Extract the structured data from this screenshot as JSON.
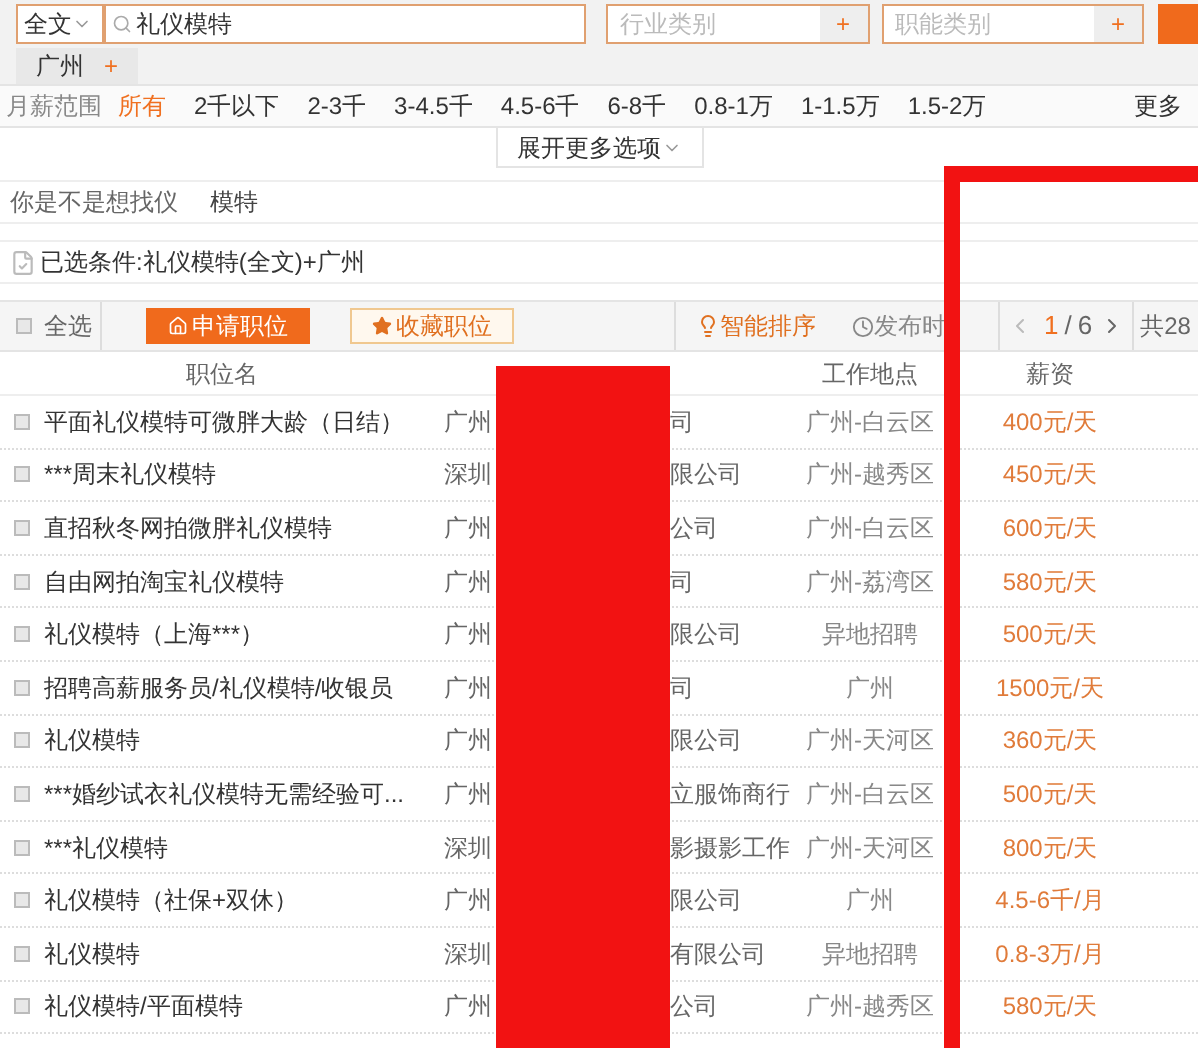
{
  "search": {
    "scope": "全文",
    "query": "礼仪模特",
    "industry_placeholder": "行业类别",
    "function_placeholder": "职能类别",
    "add_symbol": "+"
  },
  "city_tag": {
    "label": "广州",
    "add_symbol": "+"
  },
  "salary_filter": {
    "label": "月薪范围",
    "more": "更多",
    "options": [
      {
        "label": "所有",
        "selected": true
      },
      {
        "label": "2千以下",
        "selected": false
      },
      {
        "label": "2-3千",
        "selected": false
      },
      {
        "label": "3-4.5千",
        "selected": false
      },
      {
        "label": "4.5-6千",
        "selected": false
      },
      {
        "label": "6-8千",
        "selected": false
      },
      {
        "label": "0.8-1万",
        "selected": false
      },
      {
        "label": "1-1.5万",
        "selected": false
      },
      {
        "label": "1.5-2万",
        "selected": false
      }
    ]
  },
  "expand_options": "展开更多选项",
  "suggestion": {
    "prompt": "你是不是想找仪",
    "link": "模特"
  },
  "conditions": "已选条件:礼仪模特(全文)+广州",
  "toolbar": {
    "select_all": "全选",
    "select_all_checked": false,
    "apply": "申请职位",
    "save": "收藏职位",
    "smart_sort": "智能排序",
    "by_date": "发布时",
    "pager": {
      "current": "1",
      "separator": "/",
      "total": "6"
    },
    "count": "共28"
  },
  "table": {
    "columns": [
      "职位名",
      "工作地点",
      "薪资"
    ],
    "rows": [
      {
        "checked": false,
        "title": "平面礼仪模特可微胖大龄（日结）",
        "company_start": "广州",
        "company_end": "司",
        "location": "广州-白云区",
        "salary": "400元/天"
      },
      {
        "checked": false,
        "title": "***周末礼仪模特",
        "company_start": "深圳",
        "company_end": "限公司",
        "location": "广州-越秀区",
        "salary": "450元/天"
      },
      {
        "checked": false,
        "title": "直招秋冬网拍微胖礼仪模特",
        "company_start": "广州",
        "company_end": "公司",
        "location": "广州-白云区",
        "salary": "600元/天"
      },
      {
        "checked": false,
        "title": "自由网拍淘宝礼仪模特",
        "company_start": "广州",
        "company_end": "司",
        "location": "广州-荔湾区",
        "salary": "580元/天"
      },
      {
        "checked": false,
        "title": "礼仪模特（上海***）",
        "company_start": "广州",
        "company_end": "限公司",
        "location": "异地招聘",
        "salary": "500元/天"
      },
      {
        "checked": false,
        "title": "招聘高薪服务员/礼仪模特/收银员",
        "company_start": "广州",
        "company_end": "司",
        "location": "广州",
        "salary": "1500元/天"
      },
      {
        "checked": false,
        "title": "礼仪模特",
        "company_start": "广州",
        "company_end": "限公司",
        "location": "广州-天河区",
        "salary": "360元/天"
      },
      {
        "checked": false,
        "title": "***婚纱试衣礼仪模特无需经验可...",
        "company_start": "广州",
        "company_end": "立服饰商行",
        "location": "广州-白云区",
        "salary": "500元/天"
      },
      {
        "checked": false,
        "title": "***礼仪模特",
        "company_start": "深圳",
        "company_end": "影摄影工作",
        "location": "广州-天河区",
        "salary": "800元/天"
      },
      {
        "checked": false,
        "title": "礼仪模特（社保+双休）",
        "company_start": "广州",
        "company_end": "限公司",
        "location": "广州",
        "salary": "4.5-6千/月"
      },
      {
        "checked": false,
        "title": "礼仪模特",
        "company_start": "深圳",
        "company_end": "有限公司",
        "location": "异地招聘",
        "salary": "0.8-3万/月"
      },
      {
        "checked": false,
        "title": "礼仪模特/平面模特",
        "company_start": "广州",
        "company_end": "公司",
        "location": "广州-越秀区",
        "salary": "580元/天"
      }
    ]
  }
}
